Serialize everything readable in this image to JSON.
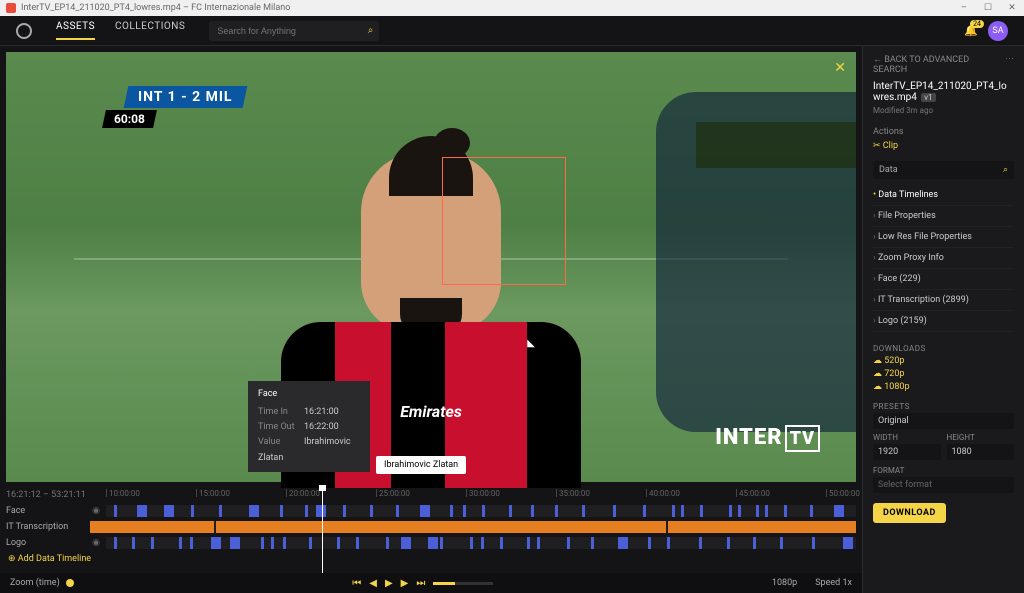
{
  "window": {
    "title": "InterTV_EP14_211020_PT4_lowres.mp4 – FC Internazionale Milano"
  },
  "topbar": {
    "nav": {
      "assets": "ASSETS",
      "collections": "COLLECTIONS"
    },
    "search_placeholder": "Search for Anything",
    "notif_count": "24",
    "avatar_initials": "SA"
  },
  "viewer": {
    "score": "INT  1 - 2  MIL",
    "clock": "60:08",
    "watermark": "INTER",
    "watermark_suffix": "TV",
    "sponsor": "Emirates",
    "tooltip": {
      "title": "Face",
      "time_in_label": "Time In",
      "time_in": "16:21:00",
      "time_out_label": "Time Out",
      "time_out": "16:22:00",
      "value_label": "Value",
      "value": "Ibrahimovic Zlatan"
    },
    "face_label": "Ibrahimovic Zlatan"
  },
  "timeline": {
    "tc_current": "16:21:12",
    "tc_total": "53:21:11",
    "ruler": [
      "10:00:00",
      "15:00:00",
      "20:00:00",
      "25:00:00",
      "30:00:00",
      "35:00:00",
      "40:00:00",
      "45:00:00",
      "50:00:00"
    ],
    "tracks": [
      {
        "label": "Face"
      },
      {
        "label": "IT Transcription"
      },
      {
        "label": "Logo"
      }
    ],
    "add_label": "Add Data Timeline"
  },
  "bottombar": {
    "zoom_label": "Zoom (time)",
    "resolution": "1080p",
    "speed": "Speed 1x"
  },
  "sidebar": {
    "back": "BACK TO ADVANCED SEARCH",
    "filename": "InterTV_EP14_211020_PT4_lowres.mp4",
    "version": "v1",
    "modified": "Modified 3m ago",
    "actions_title": "Actions",
    "clip": "Clip",
    "data_label": "Data",
    "accordion": [
      {
        "label": "Data Timelines",
        "active": true
      },
      {
        "label": "File Properties"
      },
      {
        "label": "Low Res File Properties"
      },
      {
        "label": "Zoom Proxy Info"
      },
      {
        "label": "Face (229)"
      },
      {
        "label": "IT Transcription (2899)"
      },
      {
        "label": "Logo (2159)"
      }
    ],
    "downloads_title": "DOWNLOADS",
    "downloads": [
      "520p",
      "720p",
      "1080p"
    ],
    "presets_title": "PRESETS",
    "preset_value": "Original",
    "width_label": "WIDTH",
    "width_value": "1920",
    "height_label": "HEIGHT",
    "height_value": "1080",
    "format_label": "FORMAT",
    "format_placeholder": "Select format",
    "download_btn": "DOWNLOAD"
  }
}
